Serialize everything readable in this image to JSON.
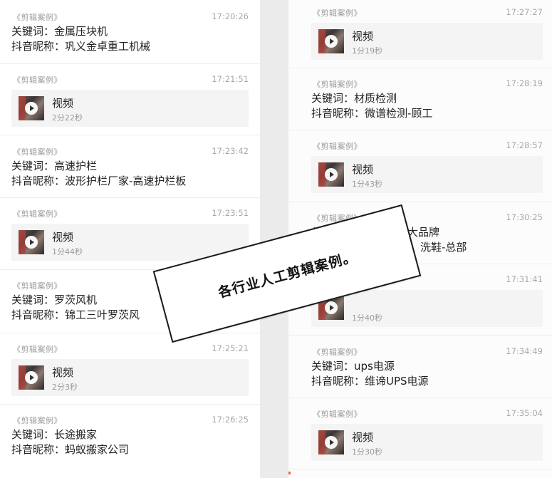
{
  "source_label": "《剪辑案例》",
  "keyword_label": "关键词：",
  "nickname_label": "抖音昵称：",
  "video_title": "视频",
  "left_messages": [
    {
      "type": "text",
      "time": "17:20:26",
      "keyword": "金属压块机",
      "nickname": "巩义金卓重工机械"
    },
    {
      "type": "video",
      "time": "17:21:51",
      "duration": "2分22秒"
    },
    {
      "type": "text",
      "time": "17:23:42",
      "keyword": "高速护栏",
      "nickname": "波形护栏厂家-高速护栏板"
    },
    {
      "type": "video",
      "time": "17:23:51",
      "duration": "1分44秒"
    },
    {
      "type": "text",
      "time": "",
      "keyword": "罗茨风机",
      "nickname": "锦工三叶罗茨风"
    },
    {
      "type": "video",
      "time": "17:25:21",
      "duration": "2分3秒"
    },
    {
      "type": "text",
      "time": "17:26:25",
      "keyword": "长途搬家",
      "nickname": "蚂蚁搬家公司"
    }
  ],
  "right_messages": [
    {
      "type": "video",
      "time": "17:27:27",
      "duration": "1分19秒"
    },
    {
      "type": "text",
      "time": "17:28:19",
      "keyword": "材质检测",
      "nickname": "微谱检测-顾工"
    },
    {
      "type": "video",
      "time": "17:28:57",
      "duration": "1分43秒"
    },
    {
      "type": "text",
      "time": "17:30:25",
      "keyword": "洗鞋加盟十大品牌",
      "nickname": "洗鞋-总部"
    },
    {
      "type": "video",
      "time": "17:31:41",
      "duration": "1分40秒"
    },
    {
      "type": "text",
      "time": "17:34:49",
      "keyword": "ups电源",
      "nickname": "维谛UPS电源"
    },
    {
      "type": "video",
      "time": "17:35:04",
      "duration": "1分30秒"
    }
  ],
  "overlay_text": "各行业人工剪辑案例。",
  "colors": {
    "accent_dot": "#f06a2a",
    "thumb_red": "#b3403a"
  }
}
